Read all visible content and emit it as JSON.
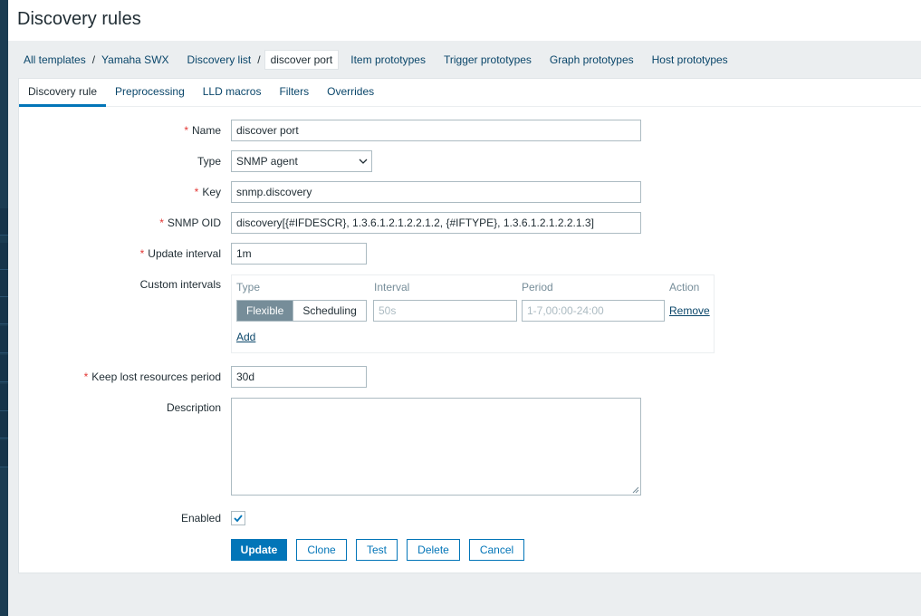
{
  "header": {
    "title": "Discovery rules"
  },
  "breadcrumbs": {
    "all_templates": "All templates",
    "template": "Yamaha SWX",
    "discovery_list": "Discovery list",
    "current": "discover port",
    "item_prototypes": "Item prototypes",
    "trigger_prototypes": "Trigger prototypes",
    "graph_prototypes": "Graph prototypes",
    "host_prototypes": "Host prototypes",
    "separator": "/"
  },
  "tabs": [
    "Discovery rule",
    "Preprocessing",
    "LLD macros",
    "Filters",
    "Overrides"
  ],
  "form": {
    "required_mark": "*",
    "name": {
      "label": "Name",
      "value": "discover port"
    },
    "type": {
      "label": "Type",
      "value": "SNMP agent"
    },
    "key": {
      "label": "Key",
      "value": "snmp.discovery"
    },
    "snmp_oid": {
      "label": "SNMP OID",
      "value": "discovery[{#IFDESCR}, 1.3.6.1.2.1.2.2.1.2, {#IFTYPE}, 1.3.6.1.2.1.2.2.1.3]"
    },
    "update_interval": {
      "label": "Update interval",
      "value": "1m"
    },
    "custom_intervals": {
      "label": "Custom intervals",
      "headers": {
        "type": "Type",
        "interval": "Interval",
        "period": "Period",
        "action": "Action"
      },
      "flexible": "Flexible",
      "scheduling": "Scheduling",
      "interval_placeholder": "50s",
      "period_placeholder": "1-7,00:00-24:00",
      "remove": "Remove",
      "add": "Add"
    },
    "keep_lost": {
      "label": "Keep lost resources period",
      "value": "30d"
    },
    "description": {
      "label": "Description",
      "value": ""
    },
    "enabled": {
      "label": "Enabled",
      "checked": true
    }
  },
  "buttons": {
    "update": "Update",
    "clone": "Clone",
    "test": "Test",
    "delete": "Delete",
    "cancel": "Cancel"
  },
  "colors": {
    "accent": "#0275b8",
    "link": "#0a466a",
    "required": "#e33734"
  }
}
